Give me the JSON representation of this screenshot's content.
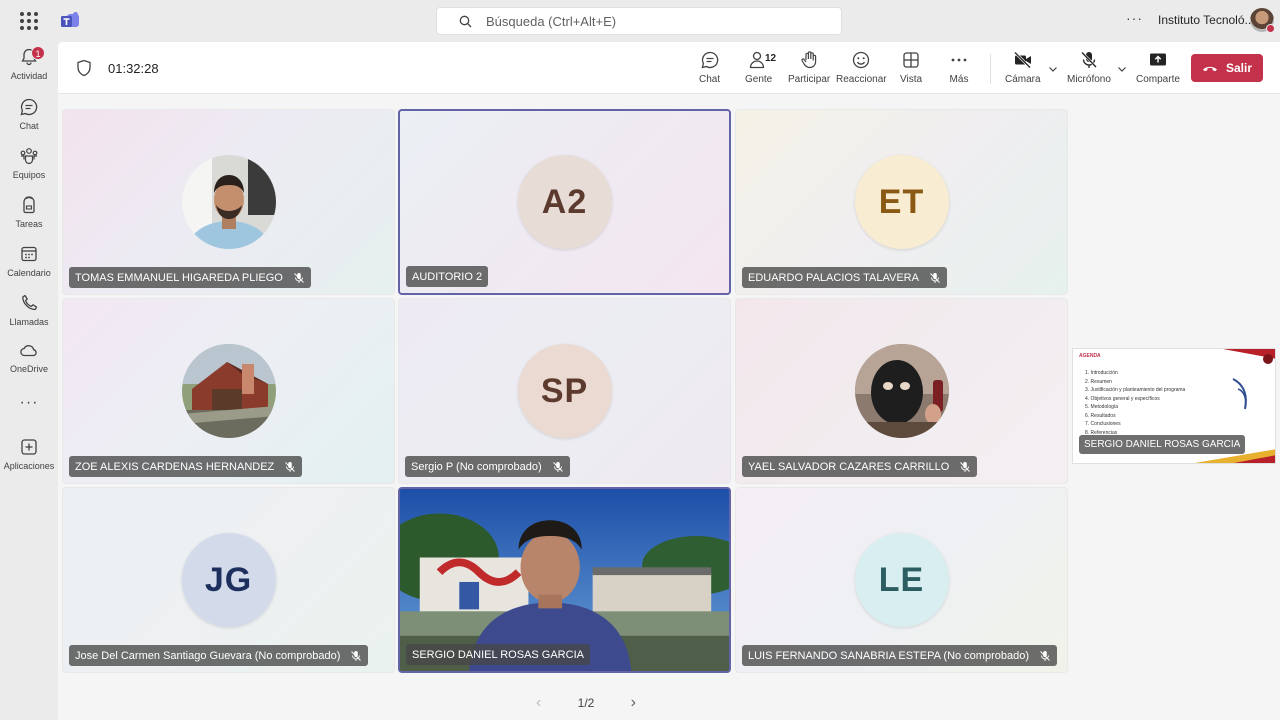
{
  "topbar": {
    "search_placeholder": "Búsqueda (Ctrl+Alt+E)",
    "org_name": "Instituto Tecnoló...",
    "more_label": "···"
  },
  "rail": {
    "items": [
      {
        "label": "Actividad",
        "icon": "bell-icon",
        "badge": "1"
      },
      {
        "label": "Chat",
        "icon": "chat-icon"
      },
      {
        "label": "Equipos",
        "icon": "teams-icon"
      },
      {
        "label": "Tareas",
        "icon": "backpack-icon"
      },
      {
        "label": "Calendario",
        "icon": "calendar-icon"
      },
      {
        "label": "Llamadas",
        "icon": "phone-icon"
      },
      {
        "label": "OneDrive",
        "icon": "cloud-icon"
      },
      {
        "label": "Aplicaciones",
        "icon": "add-app-icon"
      }
    ],
    "more_label": "···"
  },
  "meeting": {
    "timer": "01:32:28",
    "toolbar": {
      "chat": "Chat",
      "people": "Gente",
      "people_count": "12",
      "raise": "Participar",
      "react": "Reaccionar",
      "view": "Vista",
      "more": "Más",
      "camera": "Cámara",
      "mic": "Micrófono",
      "share": "Comparte",
      "leave": "Salir"
    },
    "participants": [
      {
        "name": "TOMAS EMMANUEL HIGAREDA PLIEGO",
        "muted": true,
        "type": "photo"
      },
      {
        "name": "AUDITORIO 2",
        "muted": false,
        "type": "initials",
        "initials": "A2",
        "avatar_bg": "#e8dcd7",
        "avatar_fg": "#5c3b2e"
      },
      {
        "name": "EDUARDO PALACIOS TALAVERA",
        "muted": true,
        "type": "initials",
        "initials": "ET",
        "avatar_bg": "#f8ecd3",
        "avatar_fg": "#8a5a14"
      },
      {
        "name": "ZOE ALEXIS CARDENAS HERNANDEZ",
        "muted": true,
        "type": "photo"
      },
      {
        "name": "Sergio P (No comprobado)",
        "muted": true,
        "type": "initials",
        "initials": "SP",
        "avatar_bg": "#eadad2",
        "avatar_fg": "#5c3b2e"
      },
      {
        "name": "YAEL SALVADOR CAZARES CARRILLO",
        "muted": true,
        "type": "photo"
      },
      {
        "name": "Jose Del Carmen Santiago Guevara (No comprobado)",
        "muted": true,
        "type": "initials",
        "initials": "JG",
        "avatar_bg": "#d3dbeb",
        "avatar_fg": "#1d2f5c"
      },
      {
        "name": "SERGIO DANIEL ROSAS GARCIA",
        "muted": false,
        "type": "video"
      },
      {
        "name": "LUIS FERNANDO SANABRIA ESTEPA (No comprobado)",
        "muted": true,
        "type": "initials",
        "initials": "LE",
        "avatar_bg": "#d9eef0",
        "avatar_fg": "#2c5d62"
      }
    ],
    "share": {
      "title": "AGENDA",
      "items": [
        "1.  Introducción",
        "2.  Resumen",
        "3.  Justificación y planteamiento del programa",
        "4.  Objetivos general y específicos",
        "5.  Metodología",
        "6.  Resultados",
        "7.  Conclusiones",
        "8.  Referencias"
      ],
      "presenter": "SERGIO DANIEL ROSAS GARCIA"
    },
    "pager": "1/2"
  },
  "colors": {
    "accent": "#6264a7",
    "leave": "#c4314b",
    "badge": "#c4314b"
  }
}
